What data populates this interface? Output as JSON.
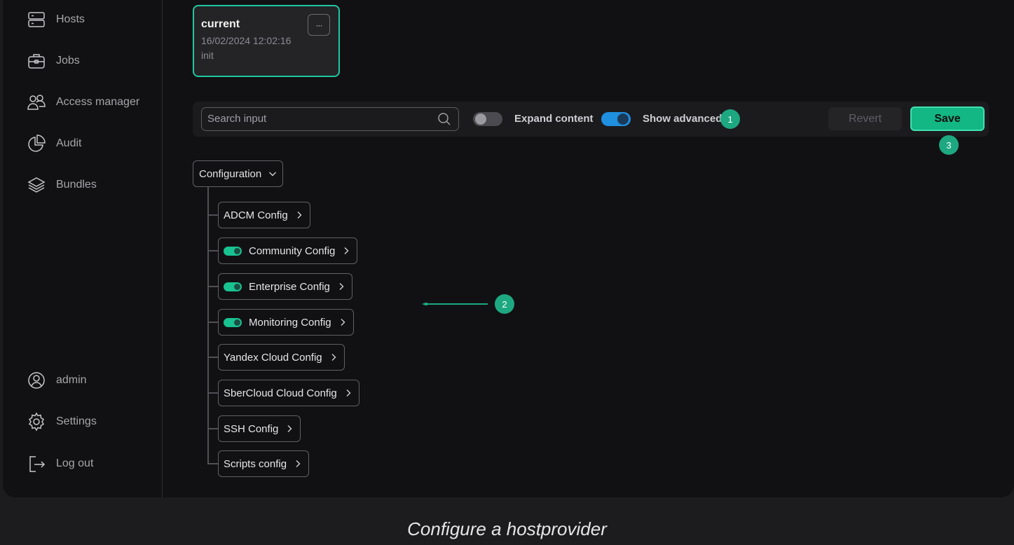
{
  "sidebar": {
    "items": [
      {
        "label": "Hosts",
        "icon": "server-icon"
      },
      {
        "label": "Jobs",
        "icon": "briefcase-icon"
      },
      {
        "label": "Access manager",
        "icon": "users-icon"
      },
      {
        "label": "Audit",
        "icon": "pie-chart-icon"
      },
      {
        "label": "Bundles",
        "icon": "layers-icon"
      }
    ],
    "bottom": [
      {
        "label": "admin",
        "icon": "user-circle-icon"
      },
      {
        "label": "Settings",
        "icon": "gear-icon"
      },
      {
        "label": "Log out",
        "icon": "logout-icon"
      }
    ]
  },
  "config_card": {
    "title": "current",
    "date": "16/02/2024 12:02:16",
    "description": "init",
    "menu_label": "···"
  },
  "toolbar": {
    "search_placeholder": "Search input",
    "expand_label": "Expand content",
    "expand_on": false,
    "advanced_label": "Show advanced",
    "advanced_on": true,
    "revert_label": "Revert",
    "save_label": "Save"
  },
  "tree": {
    "root_label": "Configuration",
    "nodes": [
      {
        "label": "ADCM Config",
        "toggle": false
      },
      {
        "label": "Community Config",
        "toggle": true
      },
      {
        "label": "Enterprise Config",
        "toggle": true
      },
      {
        "label": "Monitoring Config",
        "toggle": true
      },
      {
        "label": "Yandex Cloud Config",
        "toggle": false
      },
      {
        "label": "SberCloud Cloud Config",
        "toggle": false
      },
      {
        "label": "SSH Config",
        "toggle": false
      },
      {
        "label": "Scripts config",
        "toggle": false
      }
    ]
  },
  "annotations": {
    "badge_1": "1",
    "badge_2": "2",
    "badge_3": "3"
  },
  "colors": {
    "accent": "#1ec8a0",
    "save": "#13b784",
    "toggle_blue": "#1f8fe0",
    "badge": "#1ea882"
  },
  "caption": "Configure a hostprovider"
}
